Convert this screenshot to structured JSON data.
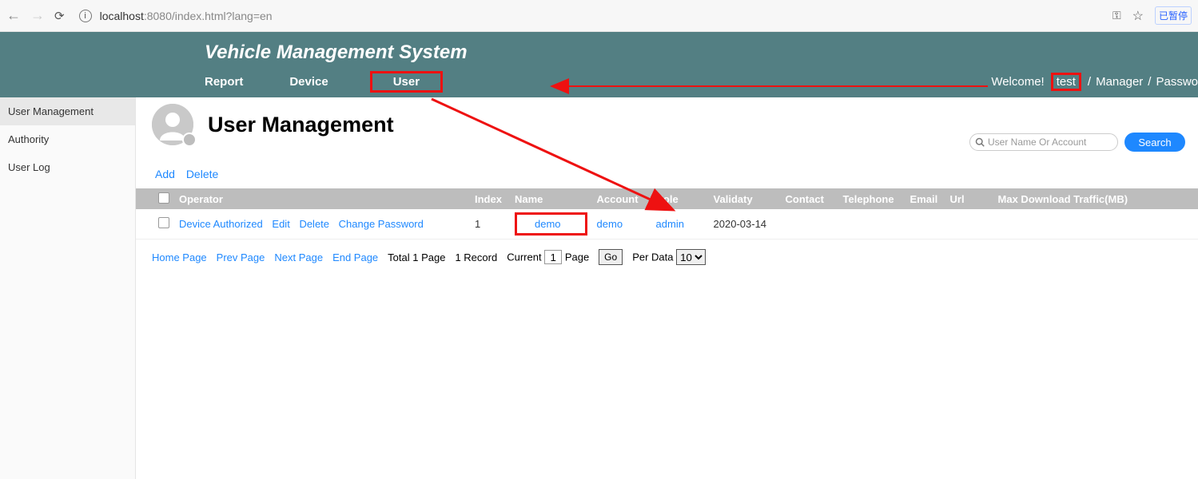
{
  "browser": {
    "url_domain": "localhost",
    "url_port": ":8080",
    "url_path": "/index.html?lang=en",
    "right_button": "已暂停"
  },
  "header": {
    "app_title": "Vehicle Management System",
    "nav": {
      "report": "Report",
      "device": "Device",
      "user": "User"
    },
    "welcome": "Welcome!",
    "user": "test",
    "sep": "/",
    "role": "Manager",
    "passwd": "Passwo"
  },
  "sidebar": {
    "items": [
      {
        "label": "User Management"
      },
      {
        "label": "Authority"
      },
      {
        "label": "User Log"
      }
    ]
  },
  "page": {
    "title": "User Management",
    "search_placeholder": "User Name Or Account",
    "search_button": "Search",
    "add": "Add",
    "delete": "Delete"
  },
  "table": {
    "headers": {
      "operator": "Operator",
      "index": "Index",
      "name": "Name",
      "account": "Account",
      "role": "Role",
      "validaty": "Validaty",
      "contact": "Contact",
      "telephone": "Telephone",
      "email": "Email",
      "url": "Url",
      "max_traffic": "Max Download Traffic(MB)"
    },
    "rows": [
      {
        "ops": {
          "device_auth": "Device Authorized",
          "edit": "Edit",
          "delete": "Delete",
          "change_pw": "Change Password"
        },
        "index": "1",
        "name": "demo",
        "account": "demo",
        "role": "admin",
        "validaty": "2020-03-14",
        "contact": "",
        "telephone": "",
        "email": "",
        "url": "",
        "max_traffic": ""
      }
    ]
  },
  "pagination": {
    "home": "Home Page",
    "prev": "Prev Page",
    "next": "Next Page",
    "end": "End Page",
    "total_prefix": "Total 1 Page",
    "record": "1 Record",
    "current": "Current",
    "current_val": "1",
    "page": "Page",
    "go": "Go",
    "per_data": "Per Data",
    "per_value": "10"
  }
}
